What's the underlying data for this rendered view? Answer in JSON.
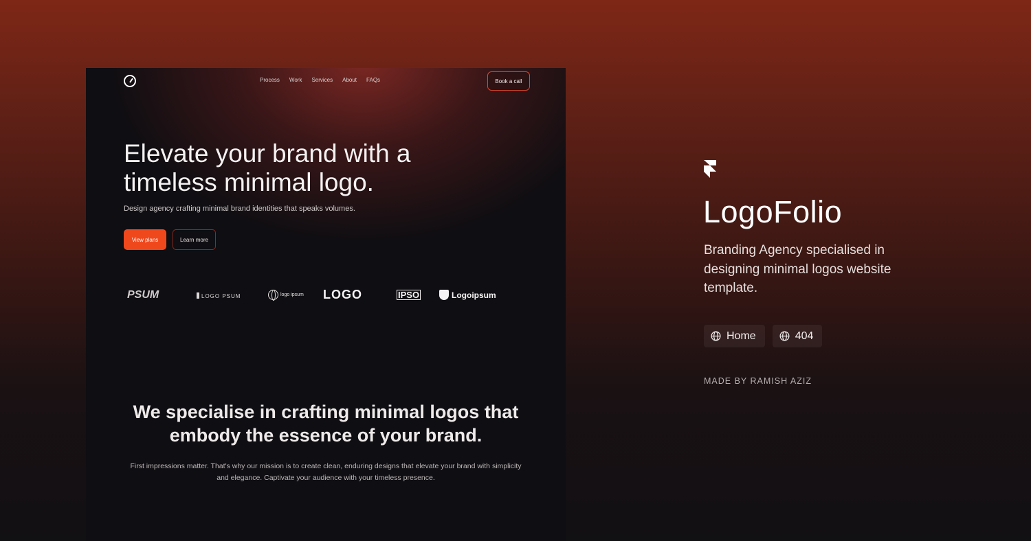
{
  "preview": {
    "nav": {
      "links": [
        "Process",
        "Work",
        "Services",
        "About",
        "FAQs"
      ],
      "book_call": "Book a call"
    },
    "hero": {
      "title": "Elevate your brand with a timeless minimal logo.",
      "subtitle": "Design agency crafting minimal brand identities that speaks volumes.",
      "primary_button": "View plans",
      "secondary_button": "Learn more"
    },
    "logo_strip": {
      "items": [
        "PSUM",
        "LOGO PSUM",
        "logo ipsum",
        "LOGO",
        "IPSO",
        "Logoipsum"
      ]
    },
    "section": {
      "title": "We specialise in crafting minimal logos that embody the essence of your brand.",
      "body": "First impressions matter. That's why our mission is to create clean, enduring designs that elevate your brand with simplicity and elegance. Captivate your audience with your timeless presence."
    }
  },
  "product": {
    "icon": "framer-icon",
    "title": "LogoFolio",
    "description": "Branding Agency specialised in designing minimal logos website template.",
    "tags": [
      {
        "icon": "globe-icon",
        "label": "Home"
      },
      {
        "icon": "globe-icon",
        "label": "404"
      }
    ],
    "credit": "MADE BY RAMISH AZIZ"
  },
  "colors": {
    "accent": "#f0481d",
    "background_top": "#7e2716",
    "background_bottom": "#111013",
    "card": "#0f0e12"
  }
}
